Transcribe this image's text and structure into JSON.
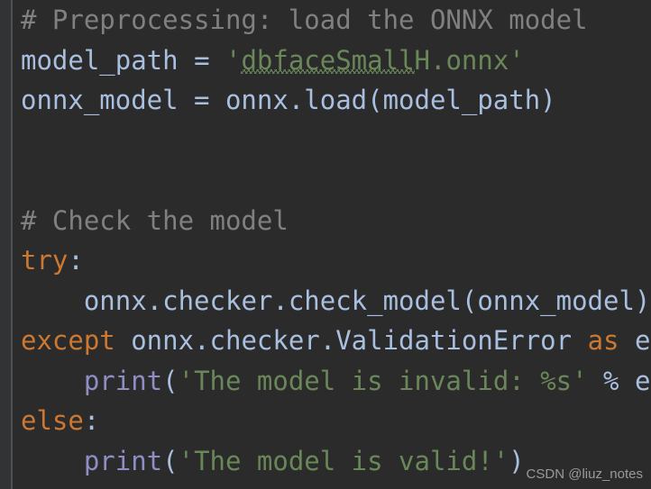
{
  "editor": {
    "theme_name": "darcula",
    "background_color": "#2b2b2b",
    "gutter_color": "#313335",
    "gutter_divider_color": "#4e5254",
    "language": "python",
    "colors": {
      "comment": "#808080",
      "identifier": "#a9bfe0",
      "keyword": "#cc7832",
      "string": "#6a8759",
      "builtin": "#8e8ec4",
      "punctuation": "#a9bfe0",
      "typo_underline": "#6a8759"
    }
  },
  "code": {
    "lines": [
      {
        "indent": "",
        "tokens": [
          {
            "text": "# Preprocessing: load the ONNX model",
            "kind": "comment"
          }
        ]
      },
      {
        "indent": "",
        "tokens": [
          {
            "text": "model_path",
            "kind": "identifier"
          },
          {
            "text": " = ",
            "kind": "punctuation"
          },
          {
            "text": "'",
            "kind": "string"
          },
          {
            "text": "dbfaceSmall",
            "kind": "string-typo"
          },
          {
            "text": "H.onnx'",
            "kind": "string"
          }
        ]
      },
      {
        "indent": "",
        "tokens": [
          {
            "text": "onnx_model = onnx.load(model_path)",
            "kind": "identifier"
          }
        ]
      },
      {
        "indent": "",
        "tokens": []
      },
      {
        "indent": "",
        "tokens": []
      },
      {
        "indent": "",
        "tokens": [
          {
            "text": "# Check the model",
            "kind": "comment"
          }
        ]
      },
      {
        "indent": "",
        "tokens": [
          {
            "text": "try",
            "kind": "keyword"
          },
          {
            "text": ":",
            "kind": "punctuation"
          }
        ]
      },
      {
        "indent": "    ",
        "tokens": [
          {
            "text": "onnx.checker.check_model(onnx_model)",
            "kind": "identifier"
          }
        ]
      },
      {
        "indent": "",
        "tokens": [
          {
            "text": "except",
            "kind": "keyword"
          },
          {
            "text": " onnx.checker.ValidationError ",
            "kind": "identifier"
          },
          {
            "text": "as",
            "kind": "keyword"
          },
          {
            "text": " e:",
            "kind": "identifier"
          }
        ]
      },
      {
        "indent": "    ",
        "tokens": [
          {
            "text": "print",
            "kind": "builtin"
          },
          {
            "text": "(",
            "kind": "punctuation"
          },
          {
            "text": "'The model is invalid: %s'",
            "kind": "string"
          },
          {
            "text": " % e)",
            "kind": "identifier"
          }
        ]
      },
      {
        "indent": "",
        "tokens": [
          {
            "text": "else",
            "kind": "keyword"
          },
          {
            "text": ":",
            "kind": "punctuation"
          }
        ]
      },
      {
        "indent": "    ",
        "tokens": [
          {
            "text": "print",
            "kind": "builtin"
          },
          {
            "text": "(",
            "kind": "punctuation"
          },
          {
            "text": "'The model is valid!'",
            "kind": "string"
          },
          {
            "text": ")",
            "kind": "punctuation"
          }
        ]
      }
    ]
  },
  "watermark": {
    "text": "CSDN @liuz_notes"
  }
}
